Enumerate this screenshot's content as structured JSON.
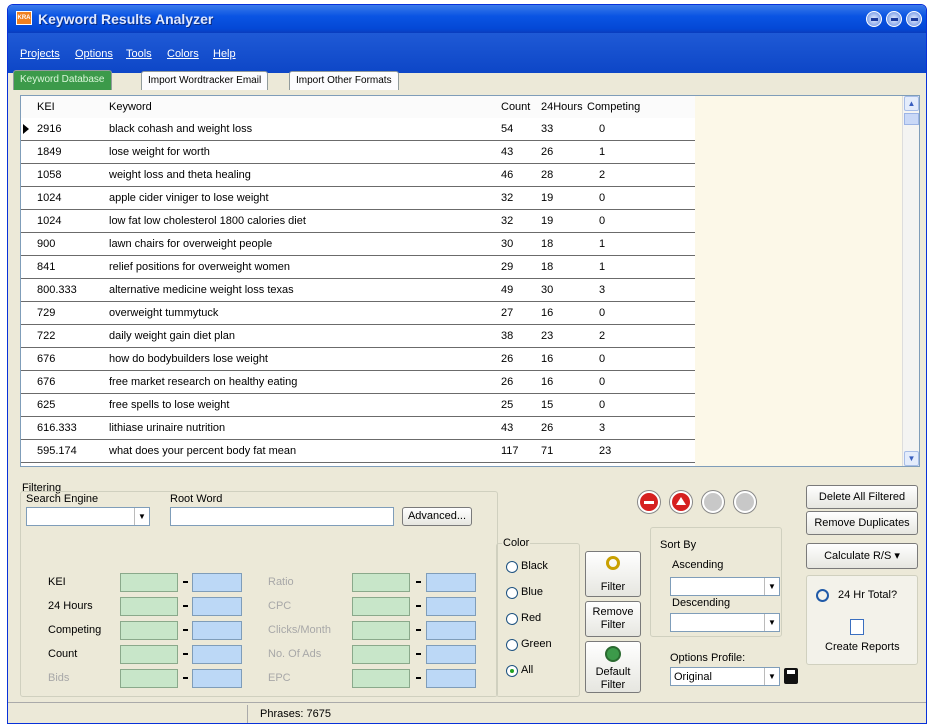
{
  "window": {
    "title": "Keyword Results Analyzer",
    "app_icon": "app-logo-icon"
  },
  "menu": [
    "Projects",
    "Options",
    "Tools",
    "Colors",
    "Help"
  ],
  "tabs": [
    "Keyword Database",
    "Import Wordtracker Email",
    "Import Other Formats"
  ],
  "grid": {
    "headers": [
      "KEI",
      "Keyword",
      "Count",
      "24Hours",
      "Competing"
    ],
    "rows": [
      {
        "kei": "2916",
        "keyword": "black cohash and weight loss",
        "count": "54",
        "h24": "33",
        "competing": "0"
      },
      {
        "kei": "1849",
        "keyword": "lose weight for worth",
        "count": "43",
        "h24": "26",
        "competing": "1"
      },
      {
        "kei": "1058",
        "keyword": "weight loss and theta healing",
        "count": "46",
        "h24": "28",
        "competing": "2"
      },
      {
        "kei": "1024",
        "keyword": "apple cider viniger to lose weight",
        "count": "32",
        "h24": "19",
        "competing": "0"
      },
      {
        "kei": "1024",
        "keyword": "low fat low cholesterol 1800 calories diet",
        "count": "32",
        "h24": "19",
        "competing": "0"
      },
      {
        "kei": "900",
        "keyword": "lawn chairs for overweight people",
        "count": "30",
        "h24": "18",
        "competing": "1"
      },
      {
        "kei": "841",
        "keyword": "relief positions for overweight women",
        "count": "29",
        "h24": "18",
        "competing": "1"
      },
      {
        "kei": "800.333",
        "keyword": "alternative medicine weight loss texas",
        "count": "49",
        "h24": "30",
        "competing": "3"
      },
      {
        "kei": "729",
        "keyword": "overweight tummytuck",
        "count": "27",
        "h24": "16",
        "competing": "0"
      },
      {
        "kei": "722",
        "keyword": "daily weight gain diet plan",
        "count": "38",
        "h24": "23",
        "competing": "2"
      },
      {
        "kei": "676",
        "keyword": "how do bodybuilders lose weight",
        "count": "26",
        "h24": "16",
        "competing": "0"
      },
      {
        "kei": "676",
        "keyword": "free market research on healthy eating",
        "count": "26",
        "h24": "16",
        "competing": "0"
      },
      {
        "kei": "625",
        "keyword": "free spells to lose weight",
        "count": "25",
        "h24": "15",
        "competing": "0"
      },
      {
        "kei": "616.333",
        "keyword": "lithiase urinaire nutrition",
        "count": "43",
        "h24": "26",
        "competing": "3"
      },
      {
        "kei": "595.174",
        "keyword": "what does your percent body fat mean",
        "count": "117",
        "h24": "71",
        "competing": "23"
      }
    ]
  },
  "filtering": {
    "title": "Filtering",
    "search_engine_label": "Search Engine",
    "root_word_label": "Root Word",
    "advanced_button": "Advanced...",
    "left_fields": [
      "KEI",
      "24 Hours",
      "Competing",
      "Count",
      "Bids"
    ],
    "right_fields": [
      "Ratio",
      "CPC",
      "Clicks/Month",
      "No. Of Ads",
      "EPC"
    ]
  },
  "color_group": {
    "title": "Color",
    "options": [
      "Black",
      "Blue",
      "Red",
      "Green",
      "All"
    ],
    "selected": "All"
  },
  "filter_buttons": {
    "filter": "Filter",
    "remove_filter": "Remove Filter",
    "default_filter": "Default Filter"
  },
  "sort": {
    "title": "Sort By",
    "ascending": "Ascending",
    "descending": "Descending"
  },
  "options_profile": {
    "label": "Options Profile:",
    "value": "Original"
  },
  "actions": {
    "delete_all_filtered": "Delete All Filtered",
    "remove_duplicates": "Remove Duplicates",
    "calculate": "Calculate R/S",
    "hr_total": "24 Hr Total?",
    "create_reports": "Create Reports"
  },
  "status": {
    "phrases": "Phrases: 7675"
  },
  "colors": {
    "titlebar": "#0a54e3",
    "active_tab": "#3c9a4a",
    "green_field": "#c8e6c9",
    "blue_field": "#bcd8f6"
  }
}
